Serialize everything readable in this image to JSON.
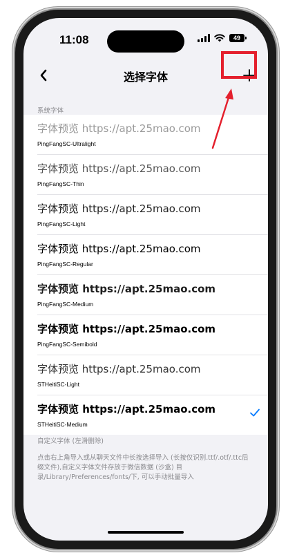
{
  "status_bar": {
    "time": "11:08",
    "battery": "49"
  },
  "nav": {
    "title": "选择字体",
    "back_icon": "chevron-left-icon",
    "add_icon": "plus-icon"
  },
  "system_section": {
    "header": "系统字体",
    "items": [
      {
        "preview": "字体预览 https://apt.25mao.com",
        "name": "PingFangSC-Ultralight",
        "selected": false
      },
      {
        "preview": "字体预览 https://apt.25mao.com",
        "name": "PingFangSC-Thin",
        "selected": false
      },
      {
        "preview": "字体预览 https://apt.25mao.com",
        "name": "PingFangSC-Light",
        "selected": false
      },
      {
        "preview": "字体预览 https://apt.25mao.com",
        "name": "PingFangSC-Regular",
        "selected": false
      },
      {
        "preview": "字体预览 https://apt.25mao.com",
        "name": "PingFangSC-Medium",
        "selected": false
      },
      {
        "preview": "字体预览 https://apt.25mao.com",
        "name": "PingFangSC-Semibold",
        "selected": false
      },
      {
        "preview": "字体预览 https://apt.25mao.com",
        "name": "STHeitiSC-Light",
        "selected": false
      },
      {
        "preview": "字体预览 https://apt.25mao.com",
        "name": "STHeitiSC-Medium",
        "selected": true
      }
    ]
  },
  "custom_section": {
    "header": "自定义字体 (左滑删除)",
    "description": "点击右上角导入或从聊天文件中长按选择导入 (长按仅识别.ttf/.otf/.ttc后缀文件),自定义字体文件存放于微信数据 (沙盒) 目录/Library/Preferences/fonts/下, 可以手动批量导入"
  },
  "colors": {
    "accent": "#007aff",
    "annotation": "#e4202d",
    "background": "#f2f2f6"
  }
}
